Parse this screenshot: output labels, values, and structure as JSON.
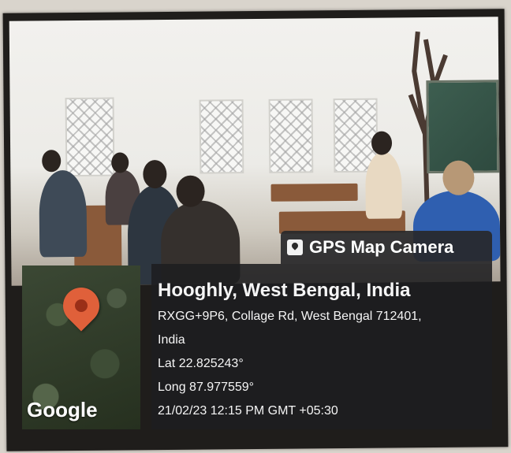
{
  "badge": {
    "title": "GPS Map Camera",
    "icon": "gps-camera-icon"
  },
  "location": {
    "title": "Hooghly, West Bengal, India",
    "address_line1": "RXGG+9P6, Collage Rd, West Bengal 712401,",
    "address_line2": "India",
    "lat": "Lat 22.825243°",
    "long": "Long 87.977559°",
    "datetime": "21/02/23 12:15 PM GMT +05:30"
  },
  "map": {
    "attribution": "Google",
    "pin_color": "#e0603a"
  },
  "colors": {
    "overlay": "#1e1e20",
    "text": "#f5f5f5"
  }
}
